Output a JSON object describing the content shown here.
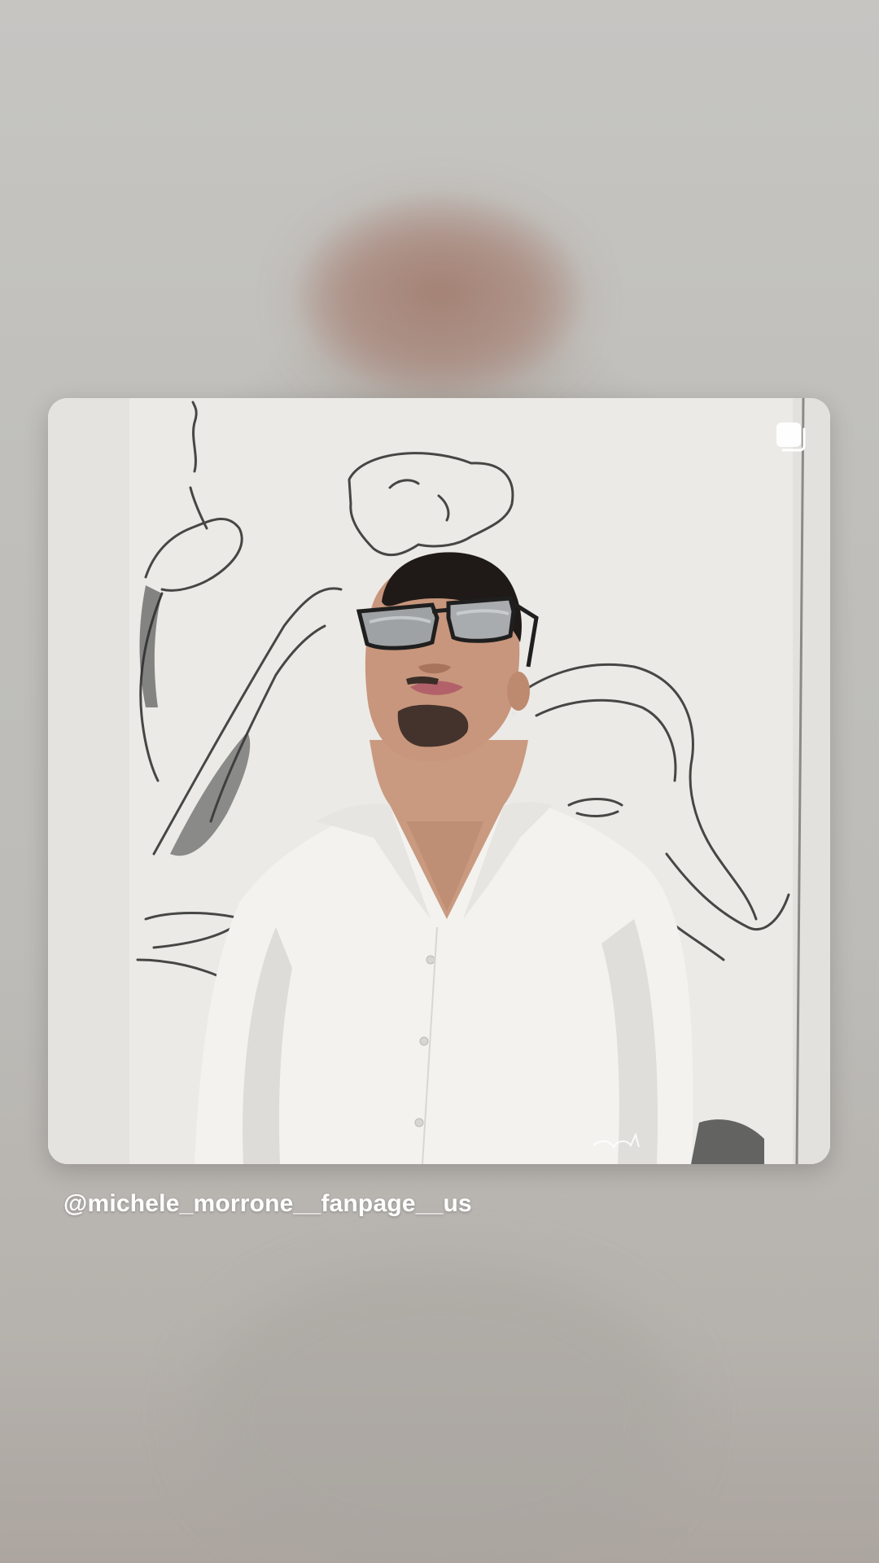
{
  "story": {
    "mention": "@michele_morrone__fanpage__us",
    "post_image_description_icon": "carousel-multiple-icon",
    "colors": {
      "background": "#bdbcb8",
      "text": "#ffffff",
      "card_background": "#ecebe8"
    }
  }
}
